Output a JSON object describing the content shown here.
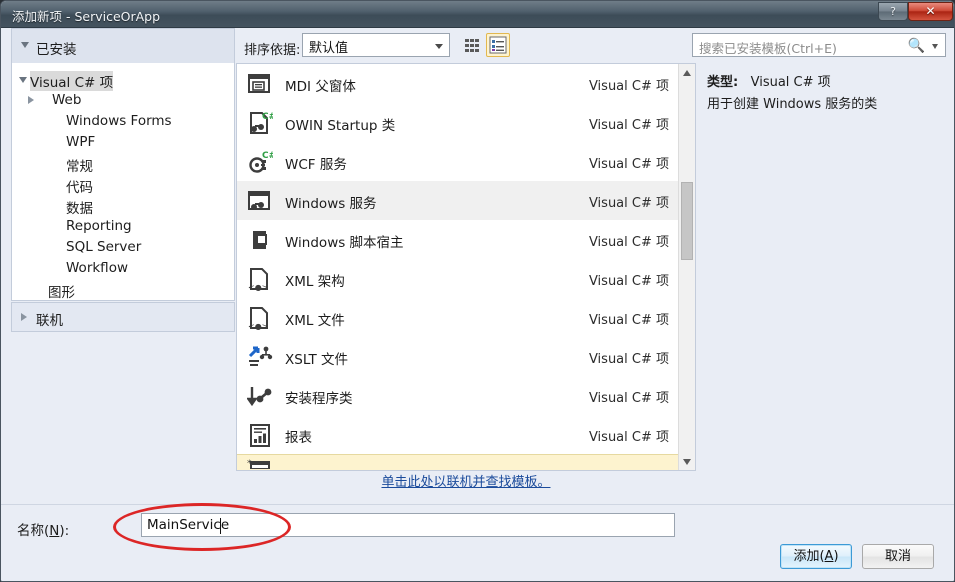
{
  "window": {
    "title": "添加新项 - ServiceOrApp",
    "help_label": "?",
    "close_label": "✕"
  },
  "toolbar": {
    "installed_label": "已安装",
    "sort_label": "排序依据:",
    "sort_value": "默认值",
    "grid_view_name": "medium-icons-view",
    "list_view_name": "list-view",
    "search_placeholder": "搜索已安装模板(Ctrl+E)",
    "search_value": ""
  },
  "tree": {
    "nodes": [
      {
        "label": "Visual C# 项",
        "indent": 8,
        "state": "expanded",
        "selected": true
      },
      {
        "label": "Web",
        "indent": 30,
        "state": "collapsed",
        "selected": false
      },
      {
        "label": "Windows Forms",
        "indent": 44,
        "state": "leaf",
        "selected": false
      },
      {
        "label": "WPF",
        "indent": 44,
        "state": "leaf",
        "selected": false
      },
      {
        "label": "常规",
        "indent": 44,
        "state": "leaf",
        "selected": false
      },
      {
        "label": "代码",
        "indent": 44,
        "state": "leaf",
        "selected": false
      },
      {
        "label": "数据",
        "indent": 44,
        "state": "leaf",
        "selected": false
      },
      {
        "label": "Reporting",
        "indent": 44,
        "state": "leaf",
        "selected": false
      },
      {
        "label": "SQL Server",
        "indent": 44,
        "state": "leaf",
        "selected": false
      },
      {
        "label": "Workflow",
        "indent": 44,
        "state": "leaf",
        "selected": false
      },
      {
        "label": "图形",
        "indent": 26,
        "state": "leaf",
        "selected": false
      }
    ],
    "online_label": "联机"
  },
  "templates": {
    "kind_label": "Visual C# 项",
    "items": [
      {
        "name": "MDI 父窗体",
        "kind": "Visual C# 项",
        "icon": "mdi-parent-form-icon",
        "state": "normal"
      },
      {
        "name": "OWIN Startup 类",
        "kind": "Visual C# 项",
        "icon": "owin-startup-class-icon",
        "state": "normal"
      },
      {
        "name": "WCF 服务",
        "kind": "Visual C# 项",
        "icon": "wcf-service-icon",
        "state": "normal"
      },
      {
        "name": "Windows 服务",
        "kind": "Visual C# 项",
        "icon": "windows-service-icon",
        "state": "selected"
      },
      {
        "name": "Windows 脚本宿主",
        "kind": "Visual C# 项",
        "icon": "windows-script-host-icon",
        "state": "normal"
      },
      {
        "name": "XML 架构",
        "kind": "Visual C# 项",
        "icon": "xml-schema-icon",
        "state": "normal"
      },
      {
        "name": "XML 文件",
        "kind": "Visual C# 项",
        "icon": "xml-file-icon",
        "state": "normal"
      },
      {
        "name": "XSLT 文件",
        "kind": "Visual C# 项",
        "icon": "xslt-file-icon",
        "state": "normal"
      },
      {
        "name": "安装程序类",
        "kind": "Visual C# 项",
        "icon": "installer-class-icon",
        "state": "normal"
      },
      {
        "name": "报表",
        "kind": "Visual C# 项",
        "icon": "report-icon",
        "state": "normal"
      },
      {
        "name": "",
        "kind": "",
        "icon": "partial-row-icon",
        "state": "highlighted"
      }
    ],
    "online_link": "单击此处以联机并查找模板。"
  },
  "info": {
    "type_label": "类型:",
    "type_value": "Visual C# 项",
    "description": "用于创建 Windows 服务的类"
  },
  "footer": {
    "name_label_prefix": "名称",
    "name_label_key": "N",
    "name_label_suffix": "):",
    "name_value": "MainService",
    "add_label_prefix": "添加",
    "add_label_key": "A",
    "add_label_suffix": ")",
    "cancel_label": "取消"
  },
  "annotation": {
    "shape": "red-ellipse",
    "color": "#dc2626"
  },
  "colors": {
    "dialog_background": "#e9edf5",
    "panel_white": "#ffffff",
    "selected_row": "#f0f0f0",
    "highlight_row": "#fdf3cf",
    "link": "#1b4b9b",
    "accent_button": "#3c9ad6",
    "annotation": "#dc2626"
  }
}
